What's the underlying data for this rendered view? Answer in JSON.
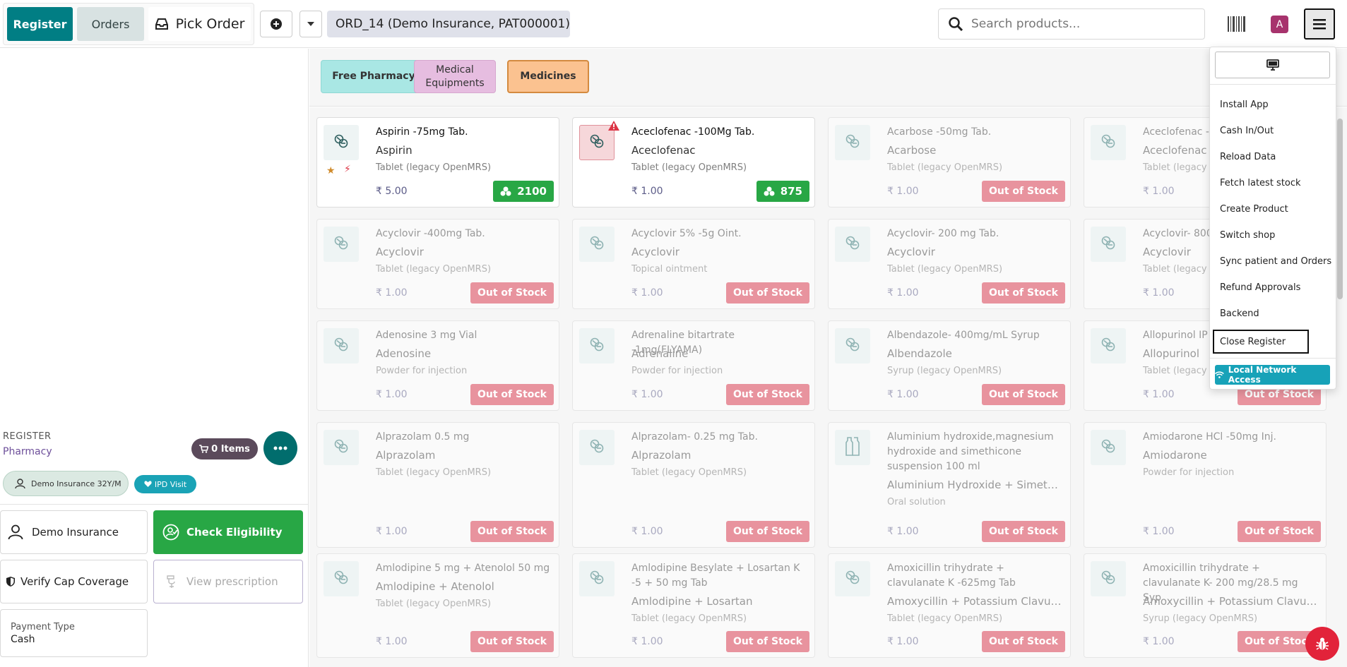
{
  "topbar": {
    "register_label": "Register",
    "orders_label": "Orders",
    "pick_order_label": "Pick Order",
    "order_title": "ORD_14 (Demo Insurance, PAT000001)",
    "search_placeholder": "Search products...",
    "avatar_letter": "A",
    "colors": {
      "primary": "#017e84",
      "avatar": "#a7336d"
    }
  },
  "register": {
    "label": "REGISTER",
    "name": "Pharmacy",
    "items_count": "0 Items",
    "patient": "Demo Insurance 32Y/M",
    "visit": "IPD Visit"
  },
  "panel": {
    "insurance": "Demo Insurance",
    "check_eligibility": "Check Eligibility",
    "verify_cap": "Verify Cap Coverage",
    "view_prescription": "View prescription",
    "payment_type_label": "Payment Type",
    "payment_type_value": "Cash"
  },
  "categories": [
    {
      "label": "Free Pharmacy"
    },
    {
      "label": "Medical Equipments"
    },
    {
      "label": "Medicines"
    }
  ],
  "products": [
    {
      "name": "Aspirin -75mg Tab.",
      "generic": "Aspirin",
      "form": "Tablet (legacy OpenMRS)",
      "price": "5.00",
      "stock": "2100",
      "status": ""
    },
    {
      "name": "Aceclofenac -100Mg Tab.",
      "generic": "Aceclofenac",
      "form": "Tablet (legacy OpenMRS)",
      "price": "1.00",
      "stock": "875",
      "status": ""
    },
    {
      "name": "Acarbose -50mg Tab.",
      "generic": "Acarbose",
      "form": "Tablet (legacy OpenMRS)",
      "price": "1.00",
      "status": "Out of Stock"
    },
    {
      "name": "Aceclofenac -",
      "generic": "Aceclofenac",
      "form": "Tablet (legacy O",
      "price": "1.00",
      "status": ""
    },
    {
      "name": "Acyclovir -400mg Tab.",
      "generic": "Acyclovir",
      "form": "Tablet (legacy OpenMRS)",
      "price": "1.00",
      "status": "Out of Stock"
    },
    {
      "name": "Acyclovir 5% -5g Oint.",
      "generic": "Acyclovir",
      "form": "Topical ointment",
      "price": "1.00",
      "status": "Out of Stock"
    },
    {
      "name": "Acyclovir- 200 mg Tab.",
      "generic": "Acyclovir",
      "form": "Tablet (legacy OpenMRS)",
      "price": "1.00",
      "status": "Out of Stock"
    },
    {
      "name": "Acyclovir- 800",
      "generic": "Acyclovir",
      "form": "Tablet (legacy O",
      "price": "1.00",
      "status": ""
    },
    {
      "name": "Adenosine 3 mg Vial",
      "generic": "Adenosine",
      "form": "Powder for injection",
      "price": "1.00",
      "status": "Out of Stock"
    },
    {
      "name": "Adrenaline bitartrate -1mg(FLYAMA)",
      "generic": "Adrenaline",
      "form": "Powder for injection",
      "price": "1.00",
      "status": "Out of Stock"
    },
    {
      "name": "Albendazole- 400mg/mL Syrup",
      "generic": "Albendazole",
      "form": "Syrup (legacy OpenMRS)",
      "price": "1.00",
      "status": "Out of Stock"
    },
    {
      "name": "Allopurinol IP",
      "generic": "Allopurinol",
      "form": "Tablet (legacy O",
      "price": "1.00",
      "status": "Out of Stock"
    },
    {
      "name": "Alprazolam 0.5 mg",
      "generic": "Alprazolam",
      "form": "Tablet (legacy OpenMRS)",
      "price": "1.00",
      "status": "Out of Stock"
    },
    {
      "name": "Alprazolam- 0.25 mg Tab.",
      "generic": "Alprazolam",
      "form": "Tablet (legacy OpenMRS)",
      "price": "1.00",
      "status": "Out of Stock"
    },
    {
      "name": "Aluminium hydroxide,magnesium hydroxide and simethicone suspension 100 ml",
      "generic": "Aluminium Hydroxide + Simethico...",
      "form": "Oral solution",
      "price": "1.00",
      "status": "Out of Stock"
    },
    {
      "name": "Amiodarone HCl -50mg Inj.",
      "generic": "Amiodarone",
      "form": "Powder for injection",
      "price": "1.00",
      "status": "Out of Stock"
    },
    {
      "name": "Amlodipine 5 mg + Atenolol 50 mg",
      "generic": "Amlodipine + Atenolol",
      "form": "Tablet (legacy OpenMRS)",
      "price": "1.00",
      "status": "Out of Stock"
    },
    {
      "name": "Amlodipine Besylate + Losartan K -5 + 50 mg Tab",
      "generic": "Amlodipine + Losartan",
      "form": "Tablet (legacy OpenMRS)",
      "price": "1.00",
      "status": "Out of Stock"
    },
    {
      "name": "Amoxicillin trihydrate + clavulanate K -625mg Tab",
      "generic": "Amoxycillin + Potassium Clavulan...",
      "form": "Tablet (legacy OpenMRS)",
      "price": "1.00",
      "status": "Out of Stock"
    },
    {
      "name": "Amoxicillin trihydrate + clavulanate K- 200 mg/28.5 mg Syp",
      "generic": "Amoxycillin + Potassium Clavulan...",
      "form": "Syrup (legacy OpenMRS)",
      "price": "1.00",
      "status": "Out of Stock"
    }
  ],
  "currency_symbol": "₹",
  "menu": {
    "items": [
      "Install App",
      "Cash In/Out",
      "Reload Data",
      "Fetch latest stock",
      "Create Product",
      "Switch shop",
      "Sync patient and Orders",
      "Refund Approvals",
      "Backend",
      "Close Register"
    ],
    "local_network": "Local Network Access"
  }
}
